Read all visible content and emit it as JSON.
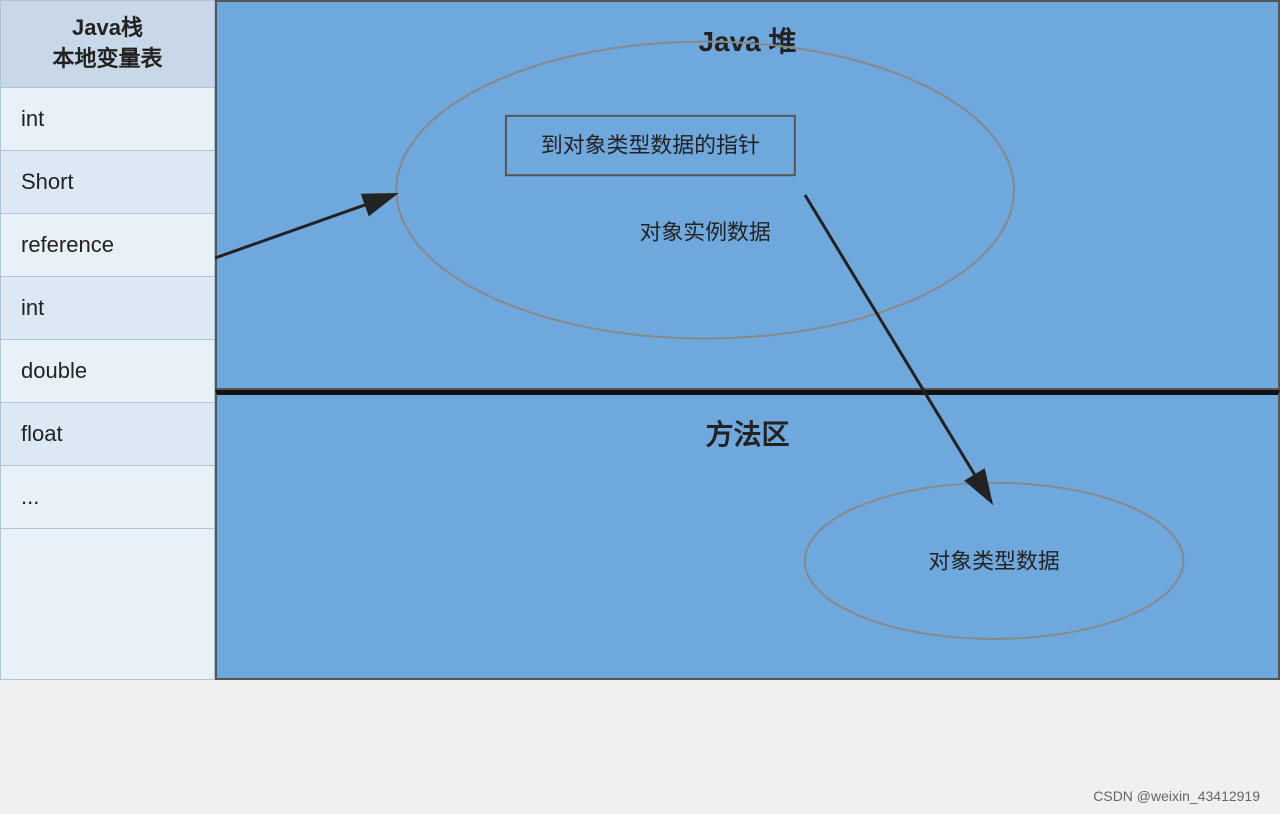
{
  "leftPanel": {
    "header": "Java栈\n本地变量表",
    "items": [
      {
        "label": "int"
      },
      {
        "label": "Short"
      },
      {
        "label": "reference"
      },
      {
        "label": "int"
      },
      {
        "label": "double"
      },
      {
        "label": "float"
      },
      {
        "label": "..."
      }
    ]
  },
  "heap": {
    "title": "Java 堆",
    "ellipse": {
      "instanceData": "对象实例数据",
      "pointer": "到对象类型数据的指针"
    }
  },
  "methodArea": {
    "title": "方法区",
    "ellipse": {
      "typeData": "对象类型数据"
    }
  },
  "footer": {
    "text": "CSDN @weixin_43412919"
  }
}
